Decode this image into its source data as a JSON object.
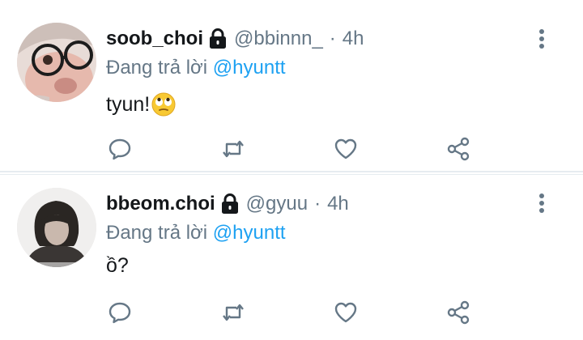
{
  "tweets": [
    {
      "display_name": "soob_choi",
      "handle": "@bbinnn_",
      "separator": "·",
      "time": "4h",
      "reply_prefix": "Đang trả lời",
      "reply_to": "@hyuntt",
      "text": "tyun!",
      "emoji": "face-with-rolling-eyes"
    },
    {
      "display_name": "bbeom.choi",
      "handle": "@gyuu",
      "separator": "·",
      "time": "4h",
      "reply_prefix": "Đang trả lời",
      "reply_to": "@hyuntt",
      "text": "ồ?"
    }
  ],
  "icons": {
    "locked": "lock-icon",
    "more": "more-vertical-icon",
    "reply": "reply-icon",
    "retweet": "retweet-icon",
    "like": "like-icon",
    "share": "share-icon"
  },
  "colors": {
    "link": "#1da1f2",
    "secondary_text": "#657786",
    "primary_text": "#14171a",
    "divider": "#e6ecf0"
  }
}
